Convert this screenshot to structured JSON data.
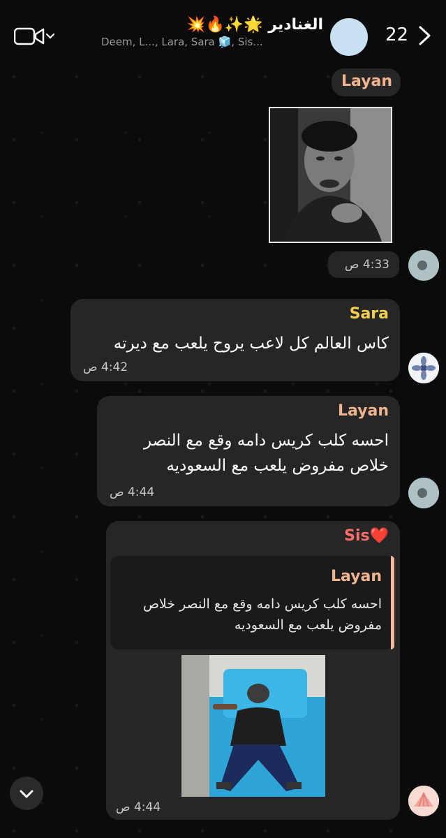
{
  "header": {
    "title": "الغنادير 🌟✨🔥💥",
    "members": "Deem, L..., Lara, Sara 🧊, Sis...",
    "unread_count": "22"
  },
  "messages": [
    {
      "sender": "Layan",
      "time": "4:33 ص",
      "type": "photo"
    },
    {
      "sender": "Sara",
      "text": "كاس العالم كل لاعب يروح يلعب مع ديرته",
      "time": "4:42 ص"
    },
    {
      "sender": "Layan",
      "text_line1": "احسه كلب كريس دامه وقع مع النصر",
      "text_line2": "خلاص مفروض يلعب مع السعوديه",
      "time": "4:44 ص"
    },
    {
      "sender": "Sis❤️",
      "reply_sender": "Layan",
      "reply_line1": "احسه كلب كريس دامه وقع مع النصر خلاص",
      "reply_line2": "مفروض يلعب مع السعوديه",
      "time": "4:44 ص",
      "type": "photo"
    }
  ],
  "colors": {
    "layan": "#f0b48f",
    "sara": "#f2cf4f",
    "sis": "#ff6e6e",
    "bubble": "#262626",
    "background": "#0b0b0b"
  }
}
